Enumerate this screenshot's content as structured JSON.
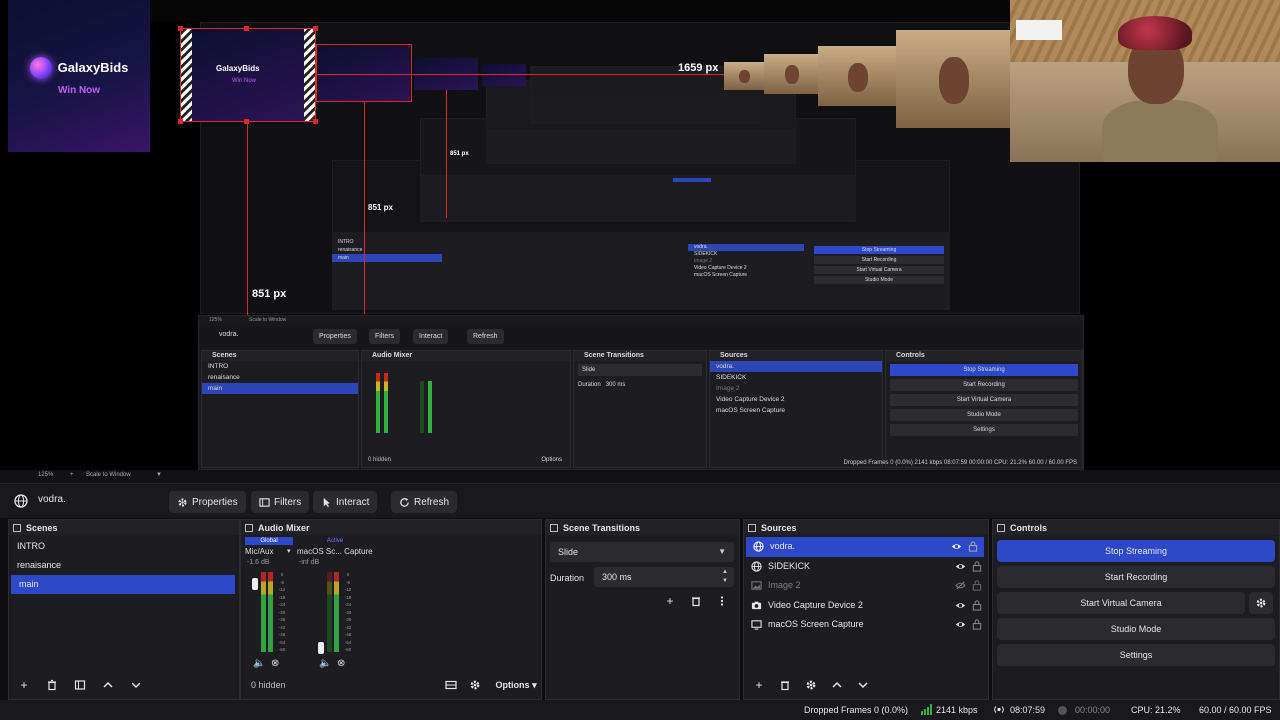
{
  "preview": {
    "brand": {
      "name": "GalaxyBids",
      "tagline": "Win Now"
    },
    "measure_labels": [
      "1659 px",
      "851 px",
      "851 px",
      "851 px"
    ],
    "nested": {
      "source_name": "vodra.",
      "toolbar": [
        "Properties",
        "Filters",
        "Interact",
        "Refresh"
      ],
      "scenes": [
        "INTRO",
        "renaisance",
        "main"
      ],
      "sources": [
        "vodra.",
        "SIDEKICK",
        "Image 2",
        "Video Capture Device 2",
        "macOS Screen Capture"
      ],
      "controls": [
        "Stop Streaming",
        "Start Recording",
        "Start Virtual Camera",
        "Studio Mode",
        "Settings"
      ],
      "transition": "Slide",
      "duration_label": "Duration",
      "duration": "300 ms",
      "hidden": "0 hidden",
      "options": "Options",
      "status": "Dropped Frames 0 (0.0%)   2141 kbps   08:07:59   00:00:00   CPU: 21.2%   60.00 / 60.00 FPS",
      "zoom": "125%",
      "zoom_mode": "Scale to Window"
    },
    "zoom": "125%",
    "zoom_mode": "Scale to Window"
  },
  "source_toolbar": {
    "source_name": "vodra.",
    "properties": "Properties",
    "filters": "Filters",
    "interact": "Interact",
    "refresh": "Refresh"
  },
  "scenes": {
    "title": "Scenes",
    "items": [
      "INTRO",
      "renaisance",
      "main"
    ],
    "selected": "main"
  },
  "mixer": {
    "title": "Audio Mixer",
    "tab_global": "Global",
    "tab_active": "Active",
    "channels": [
      {
        "name": "Mic/Aux",
        "db": "-1.6 dB"
      },
      {
        "name": "macOS Sc... Capture",
        "db": "-inf dB"
      }
    ],
    "scale": [
      "0",
      "-6",
      "-12",
      "-18",
      "-24",
      "-30",
      "-36",
      "-42",
      "-48",
      "-54",
      "-60"
    ],
    "hidden": "0 hidden",
    "options": "Options"
  },
  "transitions": {
    "title": "Scene Transitions",
    "selected": "Slide",
    "duration_label": "Duration",
    "duration": "300 ms"
  },
  "sources": {
    "title": "Sources",
    "items": [
      {
        "name": "vodra.",
        "icon": "globe-icon",
        "visible": true
      },
      {
        "name": "SIDEKICK",
        "icon": "globe-icon",
        "visible": true
      },
      {
        "name": "Image 2",
        "icon": "image-icon",
        "visible": false
      },
      {
        "name": "Video Capture Device 2",
        "icon": "camera-icon",
        "visible": true
      },
      {
        "name": "macOS Screen Capture",
        "icon": "monitor-icon",
        "visible": true
      }
    ]
  },
  "controls": {
    "title": "Controls",
    "stop_streaming": "Stop Streaming",
    "start_recording": "Start Recording",
    "start_virtual_camera": "Start Virtual Camera",
    "studio_mode": "Studio Mode",
    "settings": "Settings"
  },
  "status": {
    "dropped_frames": "Dropped Frames 0 (0.0%)",
    "bitrate": "2141 kbps",
    "stream_time": "08:07:59",
    "record_time": "00:00:00",
    "cpu": "CPU: 21.2%",
    "fps": "60.00 / 60.00 FPS"
  },
  "colors": {
    "accent": "#2d48c9",
    "measure": "#e1262b",
    "panel": "#1d1d21",
    "background": "#0e0e10"
  }
}
